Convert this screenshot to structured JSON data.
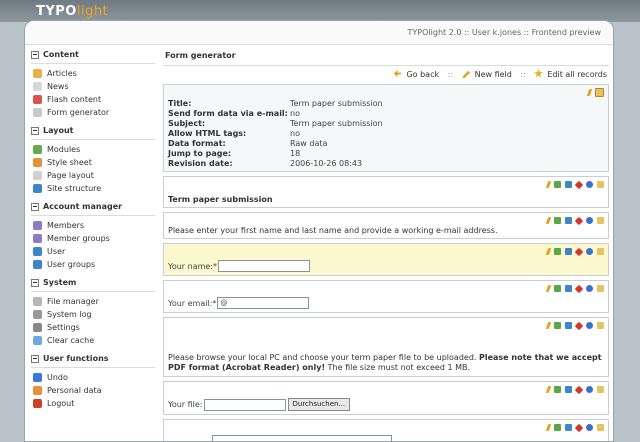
{
  "banner": {
    "logo_typo": "TYPO",
    "logo_light": "light"
  },
  "status": "TYPOlight 2.0 :: User k.jones :: Frontend preview",
  "sidebar": [
    {
      "heading": "Content",
      "items": [
        {
          "label": "Articles",
          "icon": "articles-icon",
          "color": "#e8b04a"
        },
        {
          "label": "News",
          "icon": "news-icon",
          "color": "#d8d8d8"
        },
        {
          "label": "Flash content",
          "icon": "flash-icon",
          "color": "#d9534f"
        },
        {
          "label": "Form generator",
          "icon": "form-icon",
          "color": "#c9c9c9"
        }
      ]
    },
    {
      "heading": "Layout",
      "items": [
        {
          "label": "Modules",
          "icon": "modules-icon",
          "color": "#6aa84f"
        },
        {
          "label": "Style sheet",
          "icon": "stylesheet-icon",
          "color": "#e69138"
        },
        {
          "label": "Page layout",
          "icon": "page-layout-icon",
          "color": "#d0d0d0"
        },
        {
          "label": "Site structure",
          "icon": "site-structure-icon",
          "color": "#3d85c6"
        }
      ]
    },
    {
      "heading": "Account manager",
      "items": [
        {
          "label": "Members",
          "icon": "members-icon",
          "color": "#8e7cc3"
        },
        {
          "label": "Member groups",
          "icon": "member-groups-icon",
          "color": "#8e7cc3"
        },
        {
          "label": "User",
          "icon": "user-icon",
          "color": "#3d85c6"
        },
        {
          "label": "User groups",
          "icon": "user-groups-icon",
          "color": "#3d85c6"
        }
      ]
    },
    {
      "heading": "System",
      "items": [
        {
          "label": "File manager",
          "icon": "file-manager-icon",
          "color": "#b7b7b7"
        },
        {
          "label": "System log",
          "icon": "system-log-icon",
          "color": "#999999"
        },
        {
          "label": "Settings",
          "icon": "settings-icon",
          "color": "#888888"
        },
        {
          "label": "Clear cache",
          "icon": "clear-cache-icon",
          "color": "#6fa8dc"
        }
      ]
    },
    {
      "heading": "User functions",
      "items": [
        {
          "label": "Undo",
          "icon": "undo-icon",
          "color": "#3c78d8"
        },
        {
          "label": "Personal data",
          "icon": "personal-data-icon",
          "color": "#e69138"
        },
        {
          "label": "Logout",
          "icon": "logout-icon",
          "color": "#cc4125"
        }
      ]
    }
  ],
  "main": {
    "title": "Form generator",
    "toolbar": {
      "back": "Go back",
      "new_field": "New field",
      "edit_all": "Edit all records"
    },
    "info": [
      {
        "key": "Title:",
        "value": "Term paper submission"
      },
      {
        "key": "Send form data via e-mail:",
        "value": "no"
      },
      {
        "key": "Subject:",
        "value": "Term paper submission"
      },
      {
        "key": "Allow HTML tags:",
        "value": "no"
      },
      {
        "key": "Data format:",
        "value": "Raw data"
      },
      {
        "key": "Jump to page:",
        "value": "18"
      },
      {
        "key": "Revision date:",
        "value": "2006-10-26 08:43"
      }
    ],
    "headline": "Term paper submission",
    "intro_text": "Please enter your first name and last name and provide a working e-mail address.",
    "name_label": "Your name:*",
    "email_label": "Your email:*",
    "email_value": "@",
    "upload_text_1": "Please browse your local PC and choose your term paper file to be uploaded. ",
    "upload_text_bold": "Please note that we accept PDF format (Acrobat Reader) only!",
    "upload_text_2": " The file size must not exceed 1 MB.",
    "file_label": "Your file:",
    "browse_label": "Durchsuchen..."
  }
}
